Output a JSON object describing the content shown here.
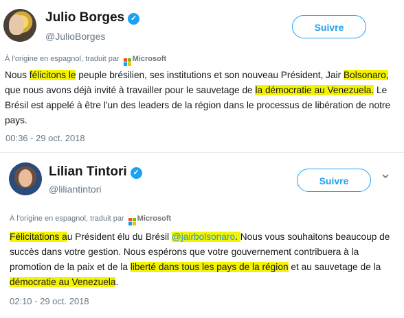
{
  "tweets": [
    {
      "name": "Julio Borges",
      "handle": "@JulioBorges",
      "follow_label": "Suivre",
      "translated_label": "À l'origine en espagnol, traduit par",
      "translator": "Microsoft",
      "body": [
        "Nous ",
        "félicitons le",
        " peuple brésilien, ses institutions et son nouveau Président, Jair ",
        "Bolsonaro,",
        " que nous avons déjà invité à travailler pour le sauvetage de ",
        "la démocratie au Venezuela.",
        " Le Brésil est appelé à être l'un des leaders de la région dans le processus de libération de notre pays."
      ],
      "timestamp": "00:36 - 29 oct. 2018"
    },
    {
      "name": "Lilian Tintori",
      "handle": "@liliantintori",
      "follow_label": "Suivre",
      "translated_label": "À l'origine en espagnol, traduit par",
      "translator": "Microsoft",
      "body": [
        "Félicitations a",
        "u Président élu du Brésil ",
        "@jairbolsonaro",
        ". ",
        "Nous vous souhaitons beaucoup de succès dans votre gestion. Nous espérons que votre gouvernement contribuera à la promotion de la paix et de la ",
        "liberté dans tous les pays de la région",
        " et au sauvetage de la ",
        "démocratie au Venezuela",
        "."
      ],
      "timestamp": "02:10 - 29 oct. 2018"
    }
  ],
  "colors": {
    "accent": "#1da1f2",
    "highlight": "#f4f400",
    "muted": "#657786",
    "ms_red": "#f25022",
    "ms_green": "#7fba00",
    "ms_blue": "#00a4ef",
    "ms_yellow": "#ffb900"
  },
  "icons": [
    "verified-badge-icon",
    "microsoft-logo-icon",
    "chevron-down-icon"
  ]
}
